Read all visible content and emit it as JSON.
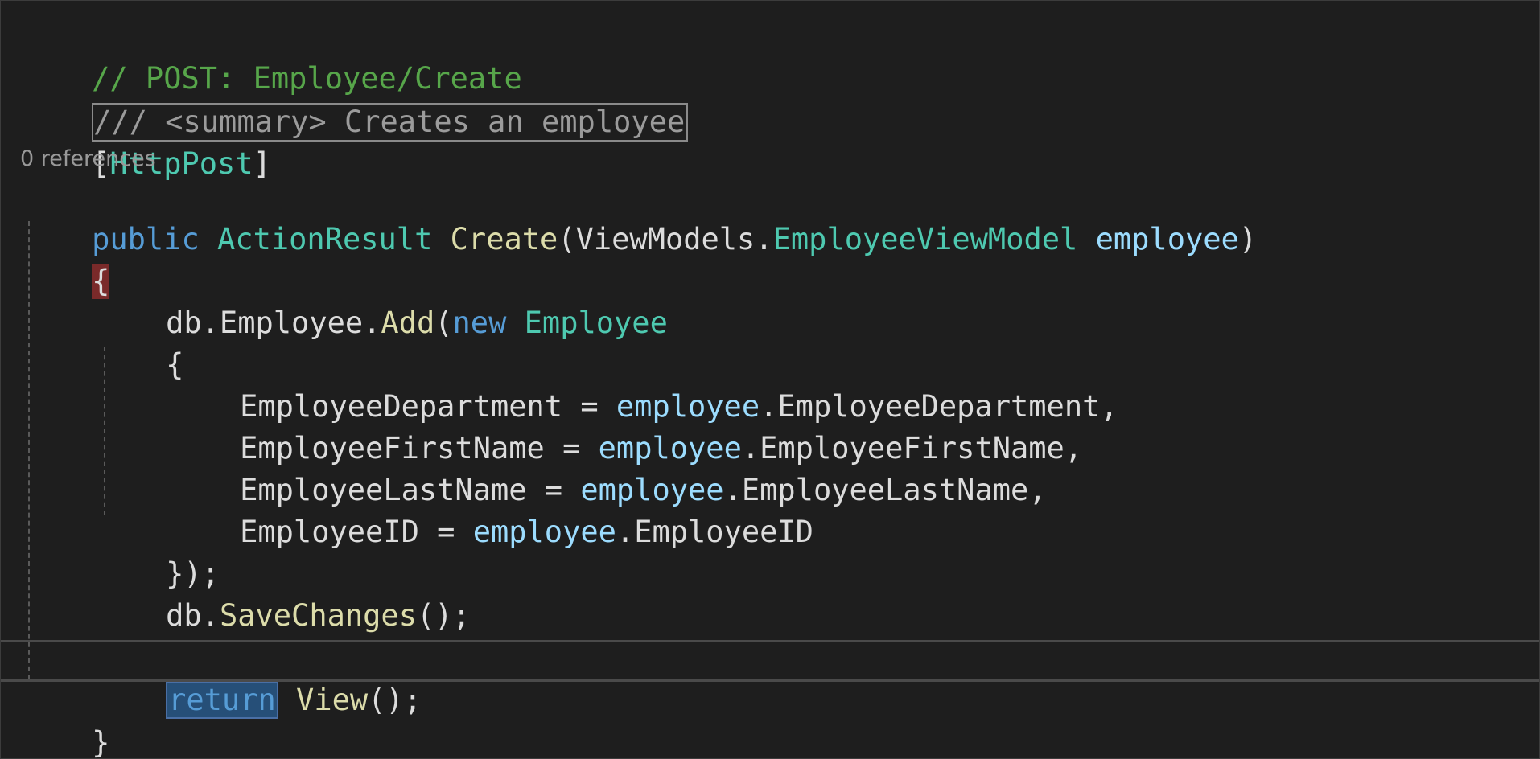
{
  "editor": {
    "language": "C#",
    "theme_colors": {
      "background": "#1e1e1e",
      "comment": "#57a64a",
      "keyword": "#569cd6",
      "type": "#4ec9b0",
      "method": "#dcdcaa",
      "parameter": "#9cdcfe"
    },
    "code_lens": "0 references",
    "lines": {
      "l1": {
        "comment": "// POST: Employee/Create"
      },
      "l2": {
        "doc_collapsed": "/// <summary> Creates an employee"
      },
      "l3": {
        "open_bracket": "[",
        "attribute": "HttpPost",
        "close_bracket": "]"
      },
      "l4": {
        "kw_public": "public",
        "sp1": " ",
        "return_type": "ActionResult",
        "sp2": " ",
        "method": "Create",
        "paren_open": "(",
        "namespace": "ViewModels.",
        "param_type": "EmployeeViewModel",
        "sp3": " ",
        "param_name": "employee",
        "paren_close": ")"
      },
      "l5": {
        "brace": "{"
      },
      "l6": {
        "db": "db.Employee.",
        "add": "Add",
        "paren": "(",
        "kw_new": "new",
        "sp": " ",
        "type": "Employee"
      },
      "l7": {
        "brace": "{"
      },
      "l8": {
        "lhs": "EmployeeDepartment = ",
        "obj": "employee",
        "rhs": ".EmployeeDepartment,"
      },
      "l9": {
        "lhs": "EmployeeFirstName = ",
        "obj": "employee",
        "rhs": ".EmployeeFirstName,"
      },
      "l10": {
        "lhs": "EmployeeLastName = ",
        "obj": "employee",
        "rhs": ".EmployeeLastName,"
      },
      "l11": {
        "lhs": "EmployeeID = ",
        "obj": "employee",
        "rhs": ".EmployeeID"
      },
      "l12": {
        "text": "});"
      },
      "l13": {
        "prefix": "db.",
        "method": "SaveChanges",
        "suffix": "();"
      },
      "l15": {
        "kw_return": "return",
        "sp": " ",
        "method": "View",
        "suffix": "();"
      },
      "l16": {
        "brace": "}"
      }
    }
  }
}
